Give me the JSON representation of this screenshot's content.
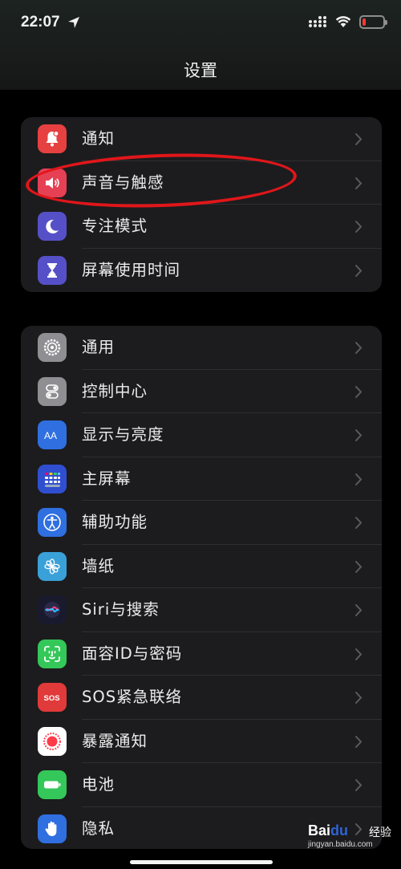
{
  "status_bar": {
    "time": "22:07",
    "battery_color": "#ff3b30"
  },
  "header": {
    "title": "设置"
  },
  "groups": [
    {
      "items": [
        {
          "label": "通知",
          "icon": "bell-icon",
          "color": "#e64040"
        },
        {
          "label": "声音与触感",
          "icon": "speaker-icon",
          "color": "#e64054",
          "highlighted": true
        },
        {
          "label": "专注模式",
          "icon": "moon-icon",
          "color": "#5650c8"
        },
        {
          "label": "屏幕使用时间",
          "icon": "hourglass-icon",
          "color": "#5650c8"
        }
      ]
    },
    {
      "items": [
        {
          "label": "通用",
          "icon": "gear-icon",
          "color": "#8e8e93"
        },
        {
          "label": "控制中心",
          "icon": "toggles-icon",
          "color": "#8e8e93"
        },
        {
          "label": "显示与亮度",
          "icon": "text-size-icon",
          "color": "#2f6fe0"
        },
        {
          "label": "主屏幕",
          "icon": "app-grid-icon",
          "color": "#2f4fd0"
        },
        {
          "label": "辅助功能",
          "icon": "accessibility-icon",
          "color": "#2f6fe0"
        },
        {
          "label": "墙纸",
          "icon": "flower-icon",
          "color": "#3aa0d8"
        },
        {
          "label": "Siri与搜索",
          "icon": "siri-icon",
          "color": "#1a1a2e"
        },
        {
          "label": "面容ID与密码",
          "icon": "face-id-icon",
          "color": "#34c759"
        },
        {
          "label": "SOS紧急联络",
          "icon": "sos-icon",
          "color": "#e03a3a"
        },
        {
          "label": "暴露通知",
          "icon": "exposure-icon",
          "color": "#ffffff"
        },
        {
          "label": "电池",
          "icon": "battery-icon",
          "color": "#34c759"
        },
        {
          "label": "隐私",
          "icon": "hand-icon",
          "color": "#2f6fe0"
        }
      ]
    }
  ],
  "watermark": {
    "logo_text_1": "Bai",
    "logo_text_2": "du",
    "logo_text_3": "经验",
    "url": "jingyan.baidu.com"
  }
}
